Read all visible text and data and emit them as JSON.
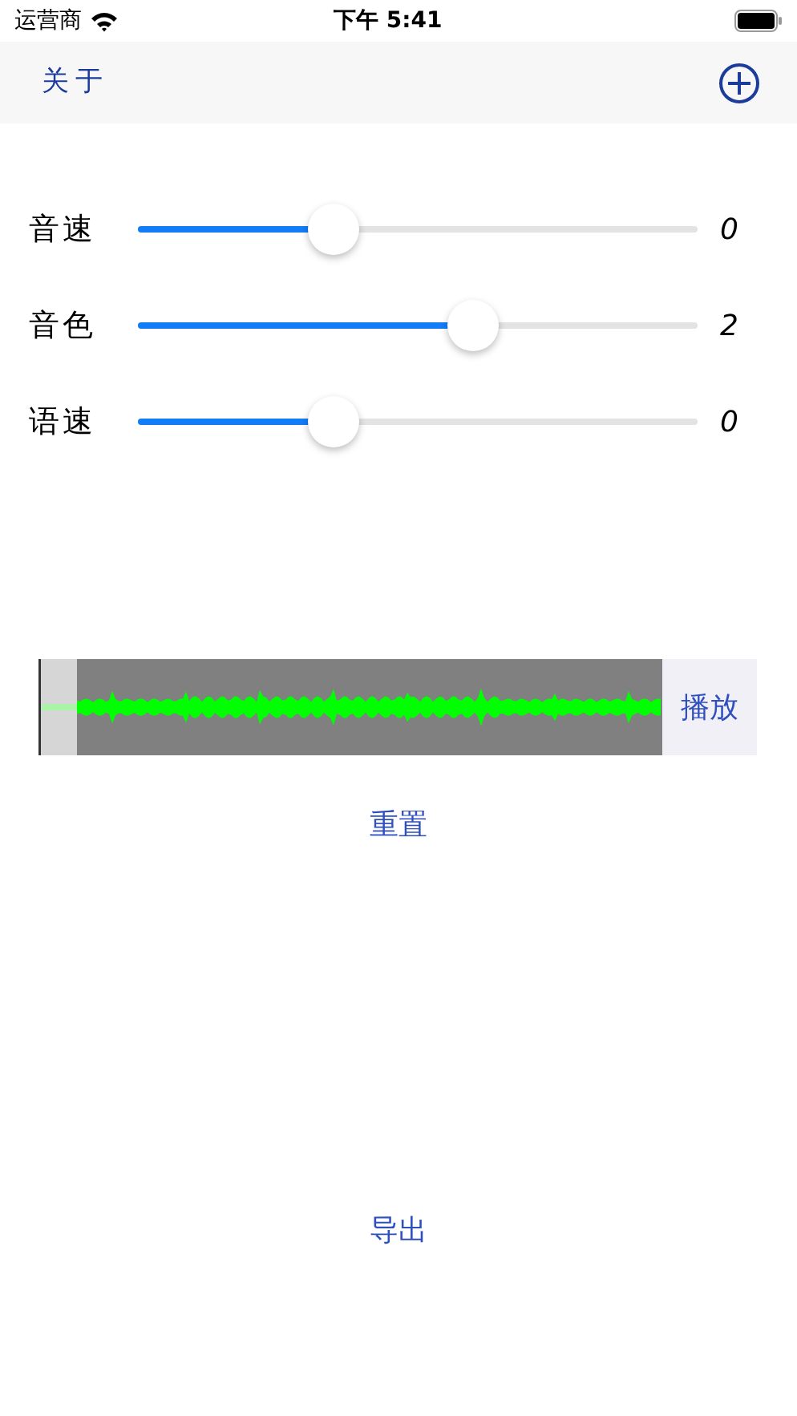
{
  "status_bar": {
    "carrier": "运营商",
    "time": "下午 5:41"
  },
  "nav_bar": {
    "left_button": "关于"
  },
  "sliders": [
    {
      "label": "音速",
      "level": 0.35,
      "value": "0"
    },
    {
      "label": "音色",
      "level": 0.6,
      "value": "2"
    },
    {
      "label": "语速",
      "level": 0.35,
      "value": "0"
    }
  ],
  "player": {
    "play_button": "播放"
  },
  "reset_button": "重置",
  "export_button": "导出"
}
